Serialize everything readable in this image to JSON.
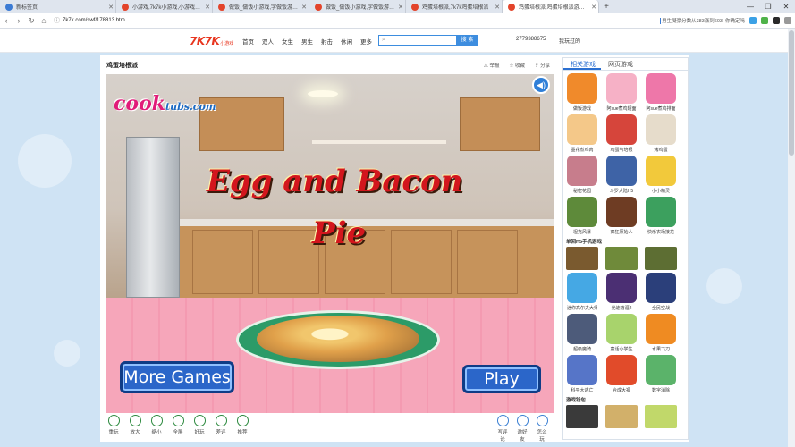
{
  "browser": {
    "tabs": [
      {
        "title": "新标签页",
        "color": "#3b7bd4"
      },
      {
        "title": "小游戏,7k7k小游戏,小游戏大全",
        "color": "#e3442b"
      },
      {
        "title": "做饭_做饭小游戏,字做饭游戏大全",
        "color": "#e3442b"
      },
      {
        "title": "做饭_做饭小游戏,字做饭游戏大全",
        "color": "#e3442b"
      },
      {
        "title": "鸡蛋培根派,7k7k鸡蛋培根派",
        "color": "#e3442b"
      },
      {
        "title": "鸡蛋培根派,鸡蛋培根派游戏在线玩",
        "color": "#e3442b",
        "active": true
      }
    ],
    "new_tab": "+",
    "url": "7k7k.com/swf/178813.htm",
    "news": "男生凝豪分数从383涨到603: 你确定吗",
    "window_controls": [
      "—",
      "❐",
      "✕"
    ]
  },
  "site": {
    "logo": "7K7K",
    "logo_sub": "小游戏",
    "menu": [
      "首页",
      "双人",
      "女生",
      "男生",
      "射击",
      "休闲",
      "更多"
    ],
    "search_button": "搜 索",
    "user_id": "2779388675",
    "login": "我玩过的"
  },
  "game": {
    "title": "鸡蛋培根派",
    "actions": [
      "举报",
      "收藏",
      "分享"
    ],
    "brand": "cook",
    "brand_sub": "tubs.com",
    "title_line1": "Egg and Bacon",
    "title_line2": "Pie",
    "more_games": "More Games",
    "play": "Play",
    "tools": [
      "重玩",
      "放大",
      "缩小",
      "全屏",
      "好玩",
      "差评",
      "推荐"
    ],
    "tools_right": [
      "写评论",
      "邀好友",
      "怎么玩"
    ]
  },
  "sidebar": {
    "tabs": [
      "相关游戏",
      "网页游戏"
    ],
    "games1": [
      {
        "label": "做饭游戏",
        "color": "#f08a2b"
      },
      {
        "label": "阿sue煮鸡翅面",
        "color": "#f6b1c6"
      },
      {
        "label": "阿sue煮鸡排面",
        "color": "#ee77a9"
      },
      {
        "label": "墨花煮鸡肉",
        "color": "#f4c889"
      },
      {
        "label": "鸡蛋与培根",
        "color": "#d6453b"
      },
      {
        "label": "烤鸡蛋",
        "color": "#e6dccb"
      },
      {
        "label": "秘密花园",
        "color": "#c77d8c"
      },
      {
        "label": "斗罗大陆H5",
        "color": "#3e63a6"
      },
      {
        "label": "小小精灵",
        "color": "#f2c93b"
      },
      {
        "label": "坦克风暴",
        "color": "#5e8a3a"
      },
      {
        "label": "疯狂原始人",
        "color": "#6e3c23"
      },
      {
        "label": "快乐农场接龙",
        "color": "#3ca05e"
      }
    ],
    "section1": "单回H5手机游戏",
    "strip1": [
      "#7a5a2f",
      "#6f8a3a",
      "#5d6e33"
    ],
    "games2": [
      {
        "label": "迷你高尔夫大师",
        "color": "#45a8e4"
      },
      {
        "label": "光速落涯2",
        "color": "#4b2f73"
      },
      {
        "label": "全民空战",
        "color": "#2b3f7a"
      },
      {
        "label": "超级魔骑",
        "color": "#4d5b7a"
      },
      {
        "label": "童话小学生",
        "color": "#a8d36c"
      },
      {
        "label": "水果飞刀",
        "color": "#ef8b22"
      },
      {
        "label": "科平大逃亡",
        "color": "#5675c8"
      },
      {
        "label": "合成大福",
        "color": "#e14b2a"
      },
      {
        "label": "数字消除",
        "color": "#5bb36a"
      }
    ],
    "section2": "游戏钱包",
    "strip2": [
      "#3a3a3a",
      "#d2b06a",
      "#c1d86a"
    ]
  }
}
